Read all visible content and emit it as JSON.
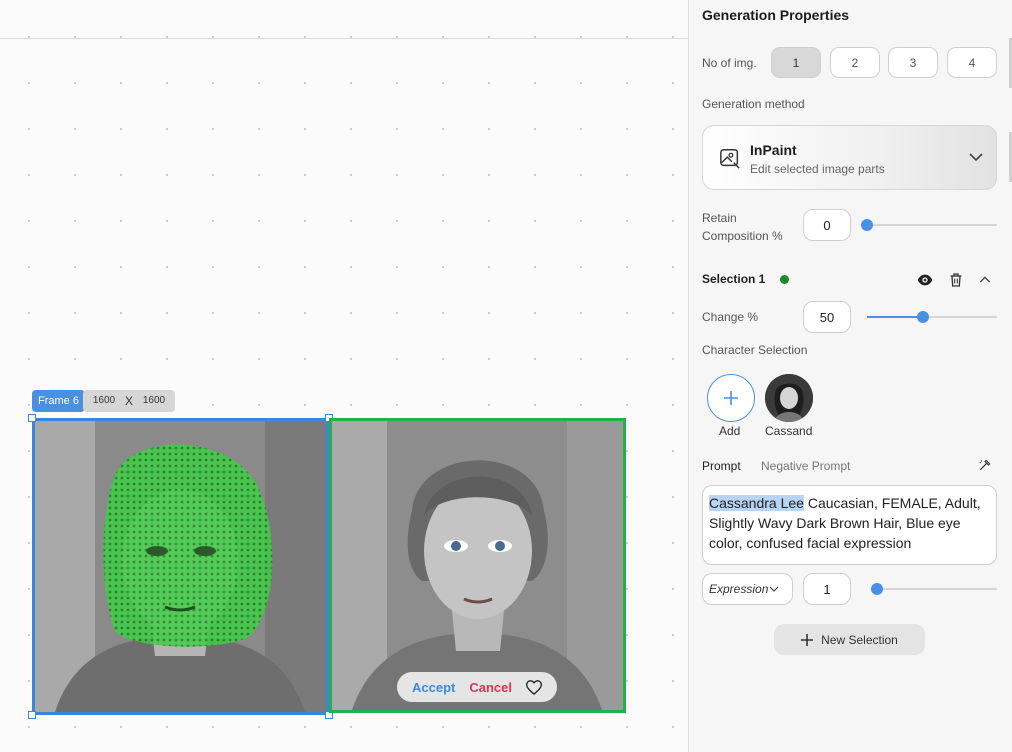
{
  "canvas": {
    "frame_label": "Frame 6",
    "frame_width": "1600",
    "frame_x": "X",
    "frame_height": "1600",
    "result_actions": {
      "accept": "Accept",
      "cancel": "Cancel"
    }
  },
  "panel": {
    "title": "Generation Properties",
    "no_of_img_label": "No of img.",
    "no_of_img_options": [
      "1",
      "2",
      "3",
      "4"
    ],
    "no_of_img_selected": "1",
    "generation_method_label": "Generation method",
    "method": {
      "title": "InPaint",
      "subtitle": "Edit selected image parts"
    },
    "retain_label_line1": "Retain",
    "retain_label_line2": "Composition %",
    "retain_value": "0",
    "retain_level": 0,
    "selection": {
      "title": "Selection 1",
      "dot_color": "#1a8a2a",
      "change_label": "Change %",
      "change_value": "50",
      "change_level": 0.5,
      "character_selection_label": "Character Selection",
      "add_label": "Add",
      "character_name": "Cassand",
      "prompt_tab": "Prompt",
      "negative_prompt_tab": "Negative Prompt",
      "prompt_highlight": "Cassandra Lee",
      "prompt_rest": " Caucasian, FEMALE, Adult, Slightly Wavy Dark Brown Hair, Blue eye color, confused facial expression",
      "expression_select": "Expression",
      "expression_value": "1"
    },
    "new_selection_label": "New Selection"
  },
  "colors": {
    "accent": "#4a90e2",
    "frame_selected": "#3a86d8",
    "frame_result": "#21b04c",
    "cancel": "#e0344f",
    "mask": "#2fbf3a"
  }
}
